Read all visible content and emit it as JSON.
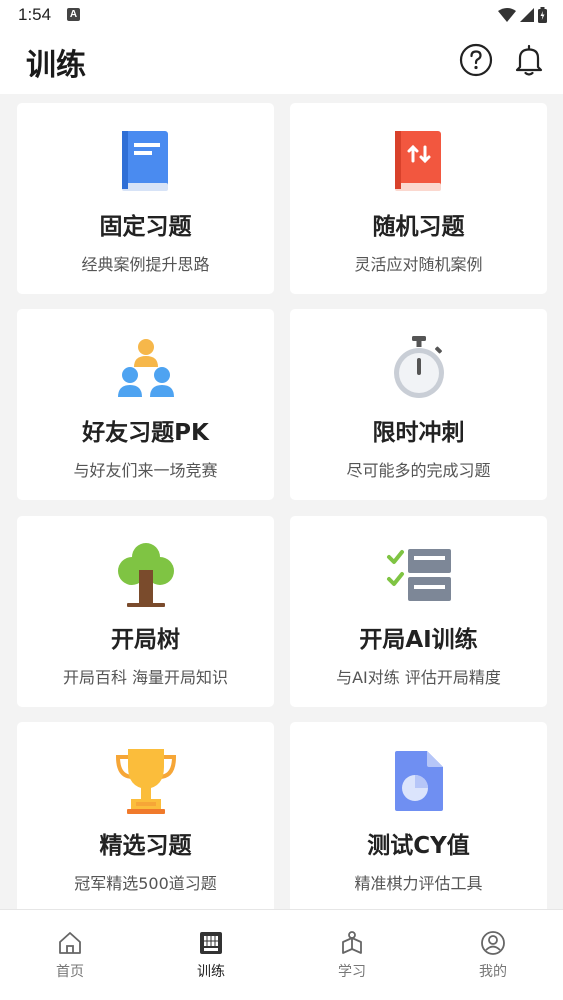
{
  "status_bar": {
    "time": "1:54",
    "notification_badge": "A"
  },
  "header": {
    "title": "训练"
  },
  "cards": [
    {
      "title": "固定习题",
      "subtitle": "经典案例提升思路",
      "icon": "blue-book-icon"
    },
    {
      "title": "随机习题",
      "subtitle": "灵活应对随机案例",
      "icon": "red-shuffle-book-icon"
    },
    {
      "title": "好友习题PK",
      "subtitle": "与好友们来一场竞赛",
      "icon": "friends-group-icon"
    },
    {
      "title": "限时冲刺",
      "subtitle": "尽可能多的完成习题",
      "icon": "stopwatch-icon"
    },
    {
      "title": "开局树",
      "subtitle": "开局百科 海量开局知识",
      "icon": "tree-icon"
    },
    {
      "title": "开局AI训练",
      "subtitle": "与AI对练 评估开局精度",
      "icon": "checklist-icon"
    },
    {
      "title": "精选习题",
      "subtitle": "冠军精选500道习题",
      "icon": "trophy-icon"
    },
    {
      "title": "测试CY值",
      "subtitle": "精准棋力评估工具",
      "icon": "pie-document-icon"
    }
  ],
  "bottom_nav": [
    {
      "label": "首页",
      "icon": "home-icon",
      "active": false
    },
    {
      "label": "训练",
      "icon": "training-board-icon",
      "active": true
    },
    {
      "label": "学习",
      "icon": "study-icon",
      "active": false
    },
    {
      "label": "我的",
      "icon": "profile-icon",
      "active": false
    }
  ],
  "colors": {
    "card_bg": "#ffffff",
    "page_bg": "#f3f3f3",
    "text_primary": "#222222",
    "text_secondary": "#555555"
  }
}
